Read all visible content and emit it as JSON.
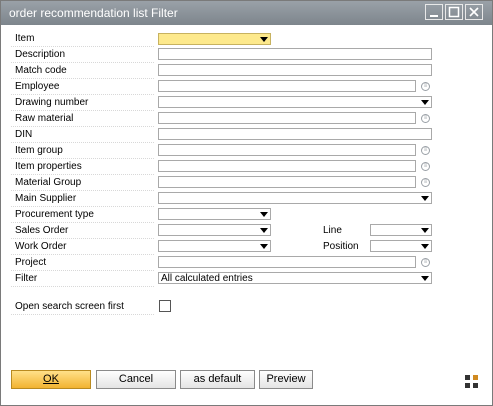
{
  "window": {
    "title": "order recommendation list Filter",
    "controls": [
      "minimize-icon",
      "maximize-icon",
      "close-icon"
    ]
  },
  "labels": {
    "item": "Item",
    "description": "Description",
    "match_code": "Match code",
    "employee": "Employee",
    "drawing_number": "Drawing number",
    "raw_material": "Raw material",
    "din": "DIN",
    "item_group": "Item group",
    "item_properties": "Item properties",
    "material_group": "Material Group",
    "main_supplier": "Main Supplier",
    "procurement_type": "Procurement type",
    "sales_order": "Sales Order",
    "line": "Line",
    "work_order": "Work Order",
    "position": "Position",
    "project": "Project",
    "filter": "Filter",
    "open_search_first": "Open search screen first"
  },
  "fields": {
    "filter_value": "All calculated entries"
  },
  "buttons": {
    "ok": "OK",
    "cancel": "Cancel",
    "as_default": "as default",
    "preview": "Preview"
  },
  "colors": {
    "title_bar": "#8a9198",
    "item_field_highlight": "#fde98c",
    "ok_button": "#f2b331"
  }
}
